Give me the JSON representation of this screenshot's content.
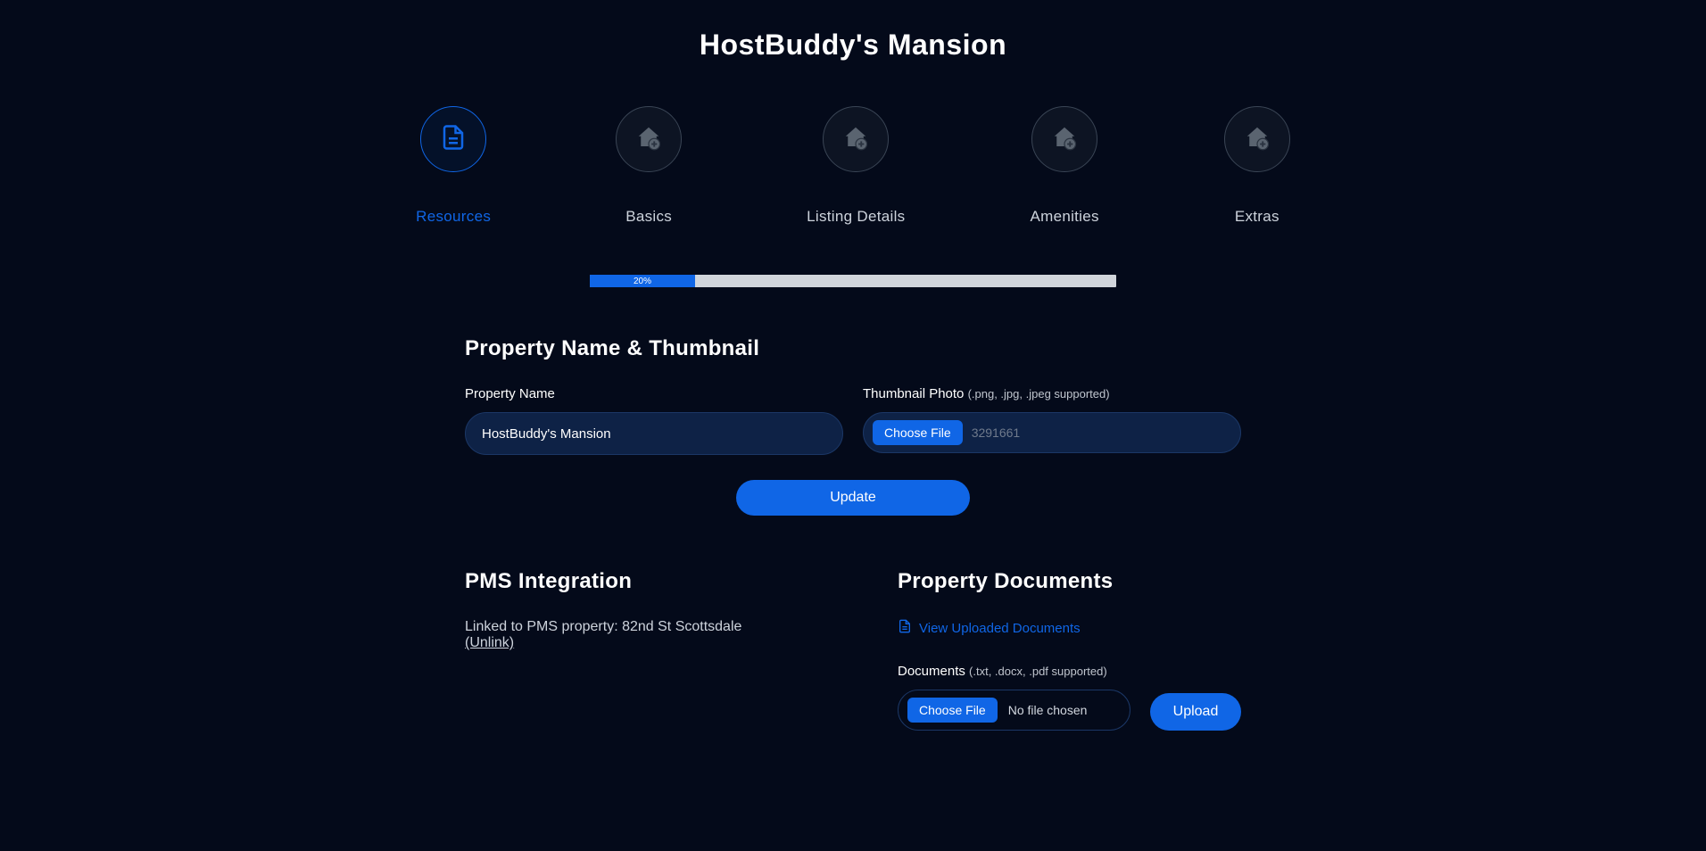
{
  "page_title": "HostBuddy's Mansion",
  "steps": [
    {
      "label": "Resources",
      "active": true
    },
    {
      "label": "Basics",
      "active": false
    },
    {
      "label": "Listing Details",
      "active": false
    },
    {
      "label": "Amenities",
      "active": false
    },
    {
      "label": "Extras",
      "active": false
    }
  ],
  "progress": {
    "percent_width": "20%",
    "label": "20%"
  },
  "section1": {
    "heading": "Property Name & Thumbnail",
    "property_name_label": "Property Name",
    "property_name_value": "HostBuddy's Mansion",
    "thumbnail_label": "Thumbnail Photo",
    "thumbnail_hint": "(.png, .jpg, .jpeg supported)",
    "choose_file_label": "Choose File",
    "file_selected": "3291661",
    "update_label": "Update"
  },
  "pms": {
    "heading": "PMS Integration",
    "linked_prefix": "Linked to PMS property: ",
    "linked_property": "82nd St Scottsdale",
    "unlink_text": "(Unlink)"
  },
  "docs": {
    "heading": "Property Documents",
    "view_link": "View Uploaded Documents",
    "documents_label": "Documents",
    "documents_hint": "(.txt, .docx, .pdf supported)",
    "choose_file_label": "Choose File",
    "no_file_text": "No file chosen",
    "upload_label": "Upload"
  }
}
